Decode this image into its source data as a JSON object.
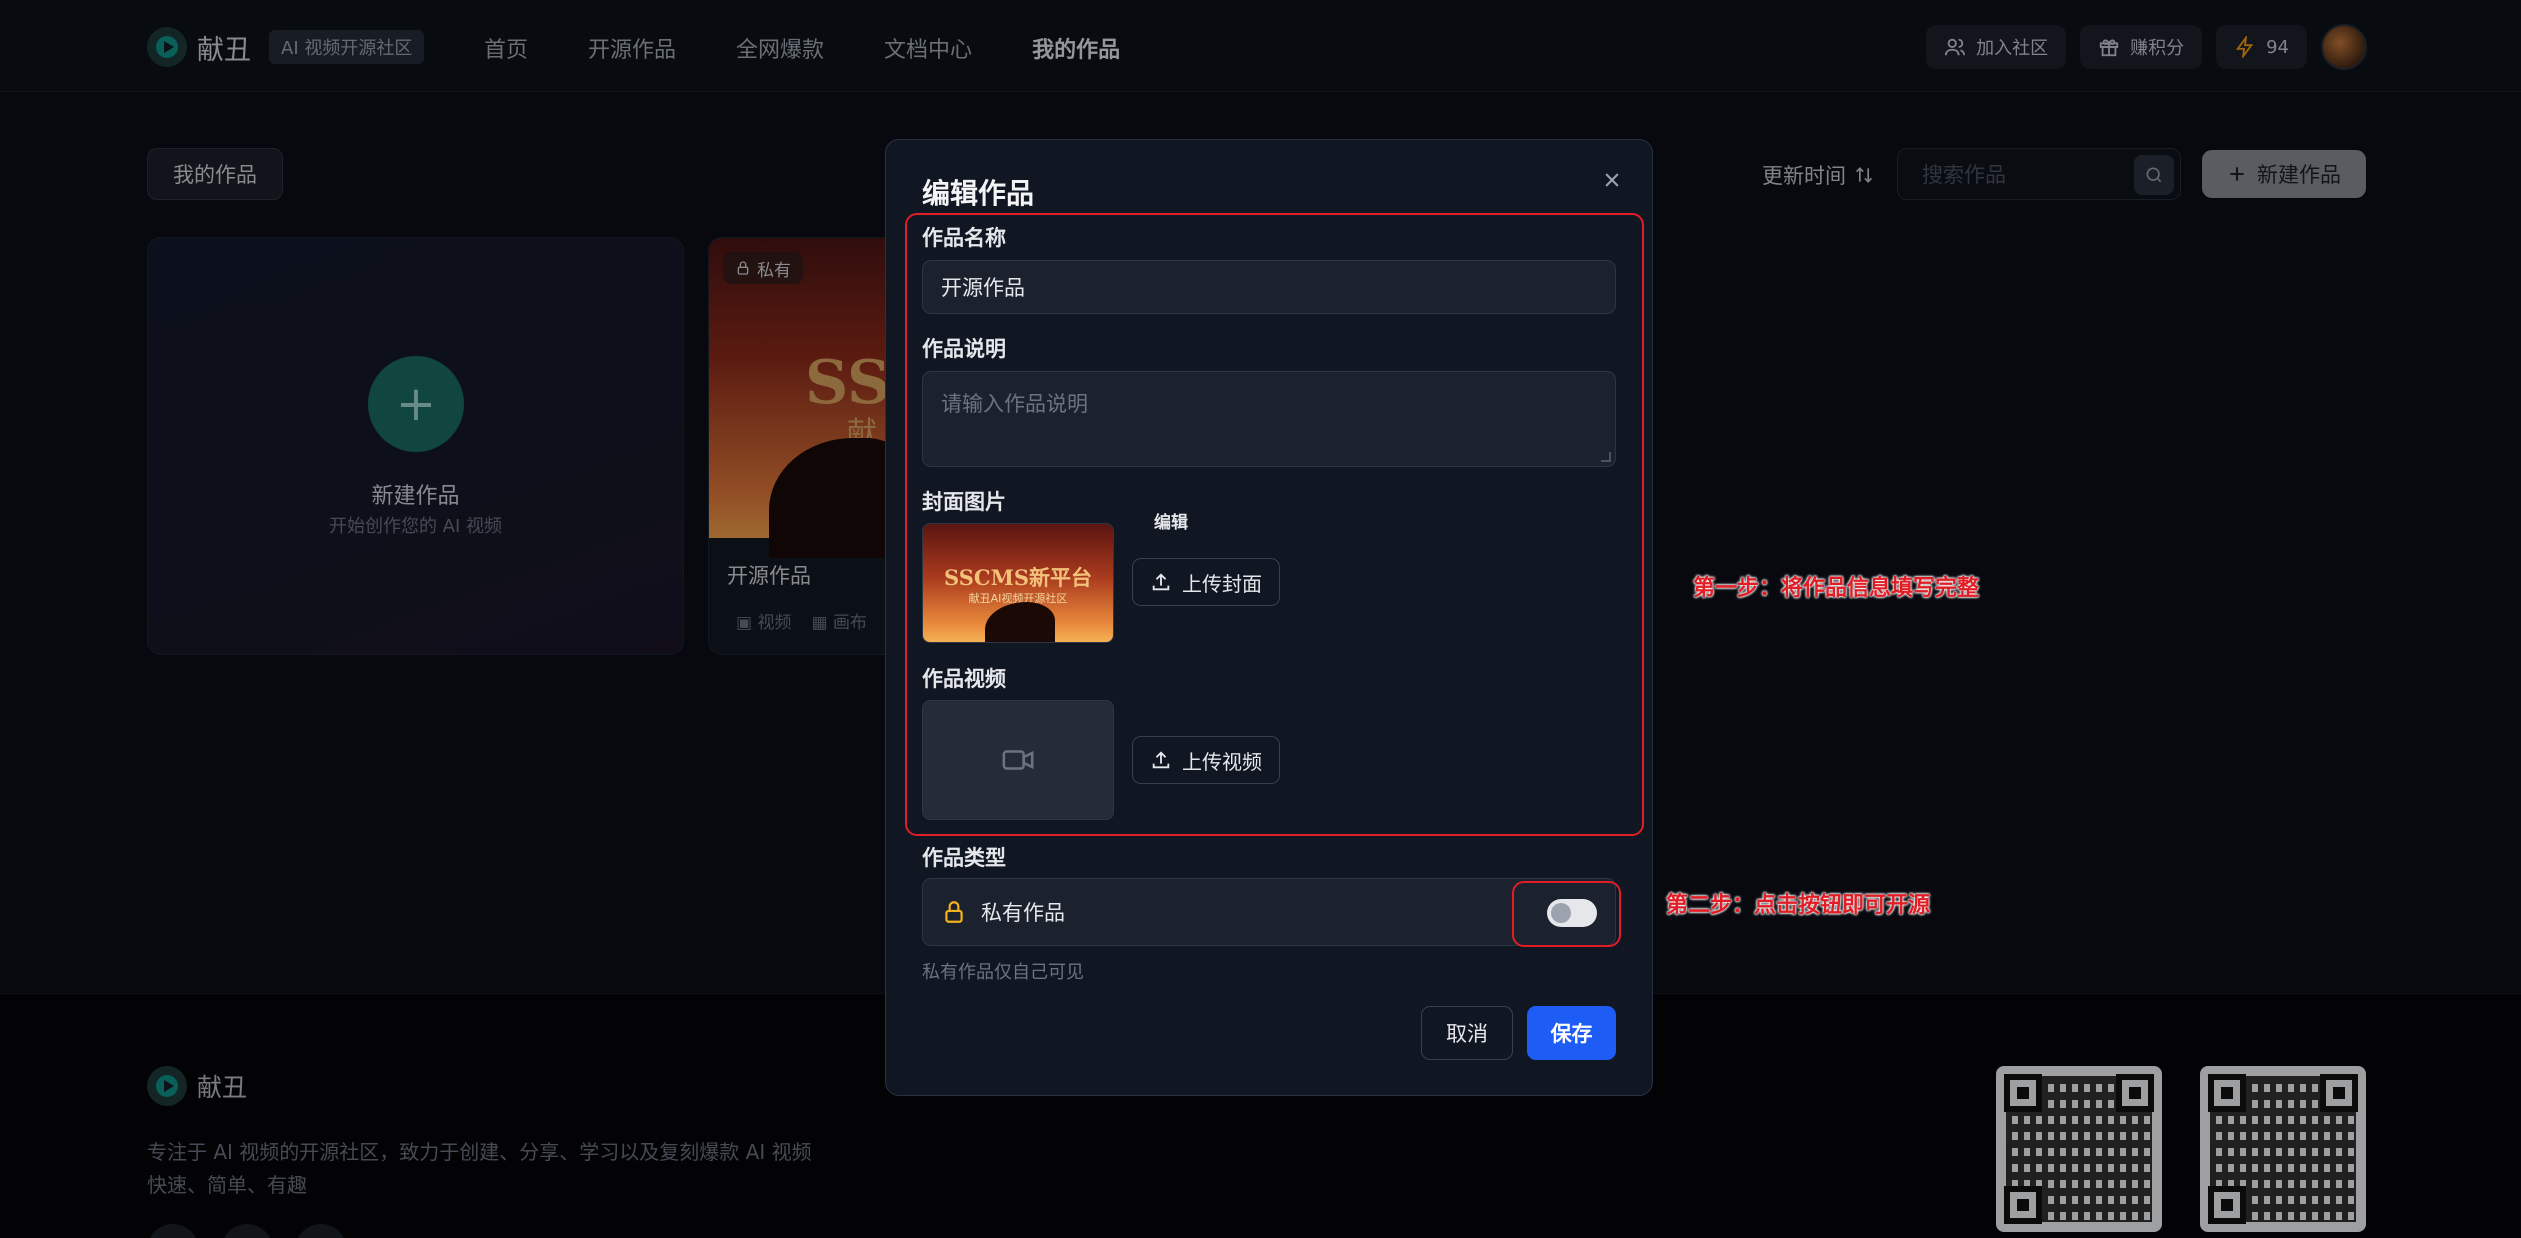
{
  "header": {
    "brand_name": "献丑",
    "brand_badge": "AI 视频开源社区",
    "nav": [
      "首页",
      "开源作品",
      "全网爆款",
      "文档中心",
      "我的作品"
    ],
    "active_nav": "我的作品",
    "join_label": "加入社区",
    "earn_label": "赚积分",
    "points": "94"
  },
  "toolbar": {
    "tab_label": "我的作品",
    "sort_label": "更新时间",
    "search_placeholder": "搜索作品",
    "new_label": "新建作品"
  },
  "cards": {
    "new_title": "新建作品",
    "new_subtitle": "开始创作您的 AI 视频",
    "work_tag": "私有",
    "work_cover_big": "SSC",
    "work_cover_small": "献",
    "work_title": "开源作品",
    "work_meta_video": "视频",
    "work_meta_canvas": "画布"
  },
  "modal": {
    "title": "编辑作品",
    "name_label": "作品名称",
    "name_value": "开源作品",
    "desc_label": "作品说明",
    "desc_placeholder": "请输入作品说明",
    "cover_label": "封面图片",
    "cover_title": "SSCMS新平台",
    "cover_subtitle": "献丑AI视频开源社区",
    "edit_label": "编辑",
    "upload_cover_label": "上传封面",
    "video_label": "作品视频",
    "upload_video_label": "上传视频",
    "type_label": "作品类型",
    "type_value": "私有作品",
    "type_hint": "私有作品仅自己可见",
    "toggle_on": false,
    "cancel_label": "取消",
    "save_label": "保存"
  },
  "annotations": {
    "step1": "第一步：将作品信息填写完整",
    "step2": "第二步：点击按钮即可开源",
    "color": "#e11d26"
  },
  "footer": {
    "brand_name": "献丑",
    "description_line1": "专注于 AI 视频的开源社区，致力于创建、分享、学习以及复刻爆款 AI 视频",
    "description_line2": "快速、简单、有趣"
  },
  "colors": {
    "accent": "#1d5cf5",
    "teal": "#0d9488",
    "background": "#0b0f17"
  }
}
